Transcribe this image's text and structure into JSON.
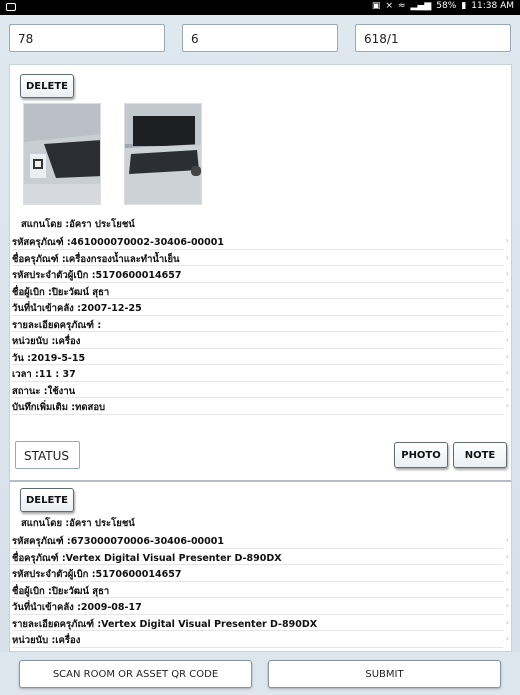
{
  "status_bar": {
    "battery": "58%",
    "time": "11:38 AM"
  },
  "top_fields": [
    "78",
    "6",
    "618/1"
  ],
  "records": [
    {
      "delete_label": "DELETE",
      "scanned_by": "สแกนโดย :อัครา ประโยชน์",
      "fields": [
        "รหัสครุภัณฑ์ :461000070002-30406-00001",
        "ชื่อครุภัณฑ์ :เครื่องกรองน้ำและทำน้ำเย็น",
        "รหัสประจำตัวผู้เบิก :5170600014657",
        "ชื่อผู้เบิก :ปิยะวัฒน์ สุธา",
        "วันที่นำเข้าคลัง :2007-12-25",
        "รายละเอียดครุภัณฑ์ :",
        "หน่วยนับ :เครื่อง",
        "วัน :2019-5-15",
        "เวลา :11 : 37",
        "สถานะ :ใช้งาน",
        "บันทึกเพิ่มเติม :ทดสอบ"
      ],
      "status_label": "STATUS",
      "photo_label": "PHOTO",
      "note_label": "NOTE"
    },
    {
      "delete_label": "DELETE",
      "scanned_by": "สแกนโดย :อัครา ประโยชน์",
      "fields": [
        "รหัสครุภัณฑ์ :673000070006-30406-00001",
        "ชื่อครุภัณฑ์ :Vertex Digital Visual Presenter D-890DX",
        "รหัสประจำตัวผู้เบิก :5170600014657",
        "ชื่อผู้เบิก :ปิยะวัฒน์ สุธา",
        "วันที่นำเข้าคลัง :2009-08-17",
        "รายละเอียดครุภัณฑ์ :Vertex Digital Visual Presenter D-890DX",
        "หน่วยนับ :เครื่อง"
      ]
    }
  ],
  "bottom_buttons": {
    "scan": "SCAN ROOM OR ASSET QR CODE",
    "submit": "SUBMIT"
  }
}
